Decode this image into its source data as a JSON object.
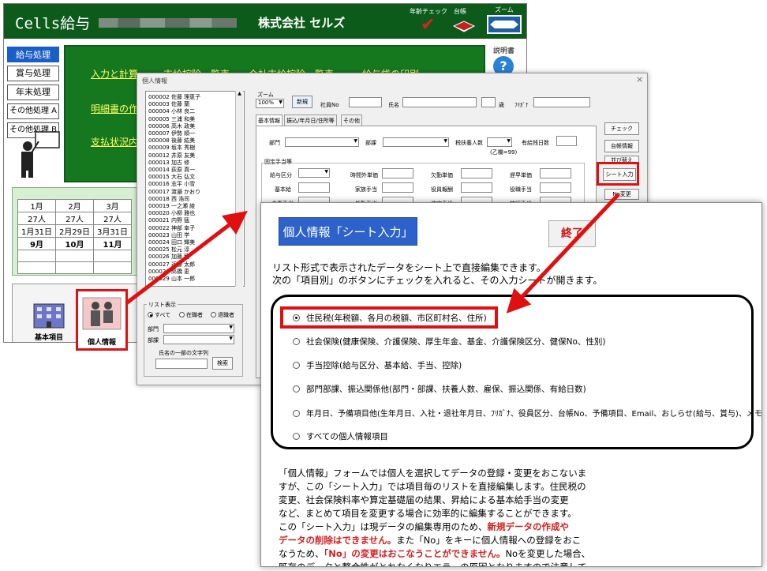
{
  "main_app": {
    "title": "Cells給与",
    "company": "株式会社 セルズ",
    "header_icons": {
      "age_check": "年齢チェック",
      "ledger": "台帳",
      "zoom": "ズーム"
    },
    "sidebar": [
      "給与処理",
      "賞与処理",
      "年末処理",
      "その他処理 A",
      "その他処理 B"
    ],
    "menu": {
      "calc": "入力と計算",
      "deduction_list": "支給控除一覧表",
      "total_deduction_list": "合計支給控除一覧表",
      "envelope_print": "給与袋の印刷",
      "statement": "明細書の作",
      "payment_status": "支払状況内"
    },
    "manual": "説明書",
    "calendar": {
      "months": [
        "1月",
        "2月",
        "3月"
      ],
      "counts": [
        "27人",
        "27人",
        "27人"
      ],
      "dates": [
        "1月31日",
        "2月29日",
        "3月31日"
      ],
      "next_months": [
        "9月",
        "10月",
        "11月"
      ]
    },
    "bottom_buttons": {
      "basic": "基本項目",
      "personal": "個人情報"
    }
  },
  "form": {
    "title": "個人情報",
    "close": "×",
    "persons": [
      "000002 佐藤 理恵子",
      "000003 佐藤 蘭",
      "000004 小林 良二",
      "000005 三浦 和美",
      "000006 高木 政美",
      "000007 伊勢 順一",
      "000008 後藤 紘美",
      "000009 坂本 秀樹",
      "000012 井原 友美",
      "000013 加古 修",
      "000014 荻原 真一",
      "000015 大石 弘文",
      "000016 志平 小雪",
      "000017 渡邉 かおり",
      "000018 西 浩司",
      "000019 一之瀬 綾",
      "000020 小柳 雅也",
      "000021 内野 猛",
      "000022 神部 幸子",
      "000023 山田 学",
      "000024 田口 輝美",
      "000025 松元 淳",
      "000026 加藤 穂",
      "000027 近藤 太郎",
      "000028 高橋 恵",
      "000029 山本 一郎"
    ],
    "list_display_label": "リスト表示",
    "list_display_options": [
      "すべて",
      "在職者",
      "退職者"
    ],
    "dept_label": "部門",
    "section_label": "部課",
    "name_search_label": "氏名の一部の文字列",
    "search_button": "検索",
    "zoom_label": "ズーム",
    "zoom_value": "100%",
    "new_button": "新規",
    "employee_no_label": "社員No",
    "name_label": "氏名",
    "age_suffix": "歳",
    "furigana_label": "ﾌﾘｶﾞﾅ",
    "tabs": [
      "基本情報",
      "振込/年月日/住所等",
      "その他"
    ],
    "fields": {
      "dept": "部門",
      "section": "部課",
      "dependents": "税扶養人数",
      "work_days": "有給残日数",
      "note_b": "(乙欄=99)",
      "fixed_allowances": "固定手当等",
      "pay_category": "給与区分",
      "overtime_rate": "時間外単価",
      "absence_rate": "欠勤単価",
      "late_rate": "遅早単価",
      "base_pay": "基本給",
      "family_allowance": "家族手当",
      "position_pay": "役員報酬",
      "position_allowance": "役職手当",
      "meal_allowance": "食事手当",
      "commute_allowance": "皆勤手当",
      "housing_allowance": "住宅手当",
      "skill_allowance": "技術手当"
    },
    "right_buttons": [
      "チェック",
      "台帳情報",
      "並び替え",
      "シート入力",
      "No変更"
    ]
  },
  "help_panel": {
    "title": "個人情報「シート入力」",
    "end_button": "終了",
    "intro_line1": "リスト形式で表示されたデータをシート上で直接編集できます。",
    "intro_line2": "次の「項目別」のボタンにチェックを入れると、その入力シートが開きます。",
    "options": [
      "住民税(年税額、各月の税額、市区町村名、住所)",
      "社会保険(健康保険、介護保険、厚生年金、基金、介護保険区分、健保No、性別)",
      "手当控除(給与区分、基本給、手当、控除)",
      "部門部課、振込関係他(部門・部課、扶養人数、雇保、振込関係、有給日数)",
      "年月日、予備項目他(生年月日、入社・退社年月日、ﾌﾘｶﾞﾅ、役員区分、台帳No、予備項目、Email、おしらせ(給与、賞与)、メモ)",
      "すべての個人情報項目"
    ],
    "description": {
      "l1": "「個人情報」フォームでは個人を選択してデータの登録・変更をおこないま",
      "l2": "すが、この「シート入力」では項目毎のリストを直接編集します。住民税の",
      "l3": "変更、社会保険料率や算定基礎届の結果、昇給による基本給手当の変更",
      "l4": "など、まとめて項目を変更する場合に効率的に編集することができます。",
      "l5a": "この「シート入力」は現データの編集専用のため、",
      "l5b": "新規データの作成や",
      "l6a": "データの削除はできません。",
      "l6b": "また「No」をキーに個人情報への登録をおこ",
      "l7a": "なうため、",
      "l7b": "「No」の変更はおこなうことができません。",
      "l7c": "Noを変更した場合、",
      "l8": "既存のデータと整合性がとれなくなりエラーの原因となりますので注意して"
    },
    "highlight_color": "#e01010",
    "title_color": "#2c62c9"
  }
}
